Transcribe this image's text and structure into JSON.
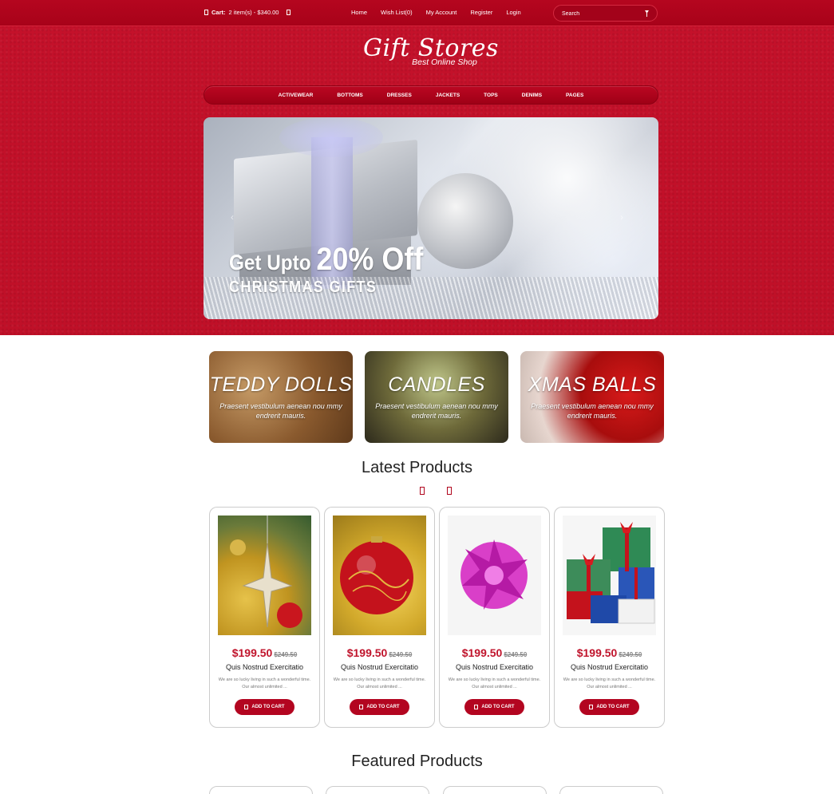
{
  "topbar": {
    "cart_label": "Cart:",
    "cart_summary": "2 item(s) - $340.00",
    "links": [
      "Home",
      "Wish List(0)",
      "My Account",
      "Register",
      "Login"
    ],
    "search_placeholder": "Search"
  },
  "logo": {
    "title": "Gift Stores",
    "tagline": "Best Online Shop"
  },
  "categories": [
    "ACTIVEWEAR",
    "BOTTOMS",
    "DRESSES",
    "JACKETS",
    "TOPS",
    "DENIMS",
    "PAGES"
  ],
  "slider": {
    "line1_prefix": "Get Upto",
    "line1_highlight": "20% Off",
    "line2": "CHRISTMAS GIFTS"
  },
  "banners": [
    {
      "title": "TEDDY DOLLS",
      "desc": "Praesent vestibulum aenean nou mmy endrerit mauris."
    },
    {
      "title": "CANDLES",
      "desc": "Praesent vestibulum aenean nou mmy endrerit mauris."
    },
    {
      "title": "XMAS BALLS",
      "desc": "Praesent vestibulum aenean nou mmy endrerit mauris."
    }
  ],
  "latest": {
    "title": "Latest Products",
    "products": [
      {
        "price": "$199.50",
        "old_price": "$249.50",
        "name": "Quis Nostrud Exercitatio",
        "desc": "We are so lucky living in such a wonderful time. Our almost unlimited ...",
        "button": "ADD TO CART"
      },
      {
        "price": "$199.50",
        "old_price": "$249.50",
        "name": "Quis Nostrud Exercitatio",
        "desc": "We are so lucky living in such a wonderful time. Our almost unlimited ...",
        "button": "ADD TO CART"
      },
      {
        "price": "$199.50",
        "old_price": "$249.50",
        "name": "Quis Nostrud Exercitatio",
        "desc": "We are so lucky living in such a wonderful time. Our almost unlimited ...",
        "button": "ADD TO CART"
      },
      {
        "price": "$199.50",
        "old_price": "$249.50",
        "name": "Quis Nostrud Exercitatio",
        "desc": "We are so lucky living in such a wonderful time. Our almost unlimited ...",
        "button": "ADD TO CART"
      }
    ]
  },
  "featured": {
    "title": "Featured Products"
  },
  "colors": {
    "brand_red": "#c01028",
    "button_red": "#b30520",
    "price_red": "#c0142c"
  }
}
